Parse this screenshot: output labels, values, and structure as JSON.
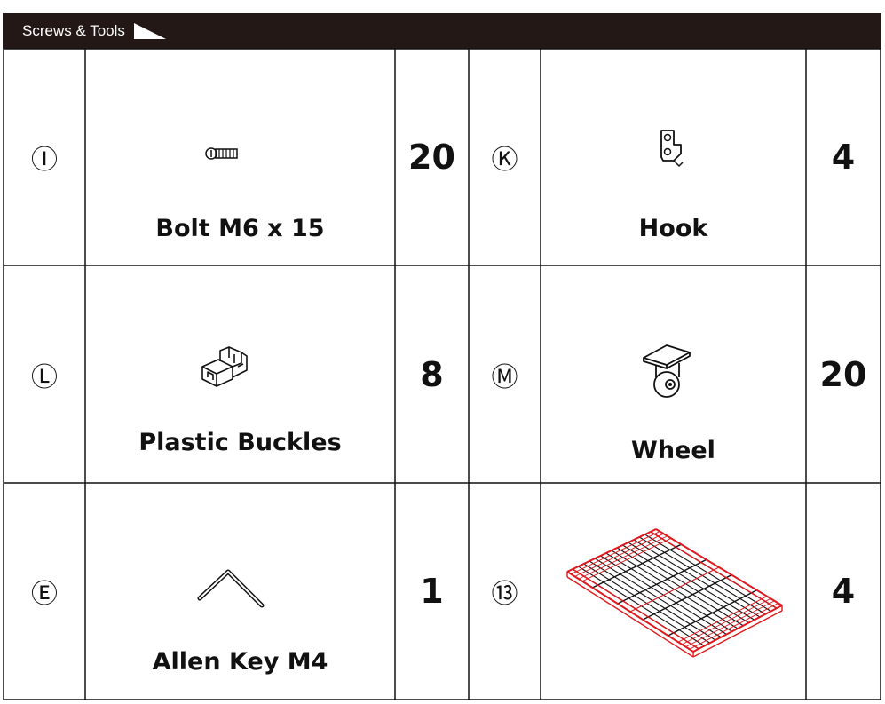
{
  "header": {
    "title": "Screws & Tools"
  },
  "rows": [
    {
      "left": {
        "marker": "Ⓘ",
        "name": "Bolt M6 x 15",
        "qty": "20",
        "icon": "bolt-icon"
      },
      "right": {
        "marker": "Ⓚ",
        "name": "Hook",
        "qty": "4",
        "icon": "hook-icon"
      }
    },
    {
      "left": {
        "marker": "Ⓛ",
        "name": "Plastic Buckles",
        "qty": "8",
        "icon": "plastic-buckle-icon"
      },
      "right": {
        "marker": "Ⓜ",
        "name": "Wheel",
        "qty": "20",
        "icon": "wheel-icon"
      }
    },
    {
      "left": {
        "marker": "Ⓔ",
        "name": "Allen Key M4",
        "qty": "1",
        "icon": "allen-key-icon"
      },
      "right": {
        "marker": "⑬",
        "name": "",
        "qty": "4",
        "icon": "wire-shelf-icon"
      }
    }
  ],
  "colors": {
    "header_bg": "#231815",
    "shelf_accent": "#e0191e"
  }
}
